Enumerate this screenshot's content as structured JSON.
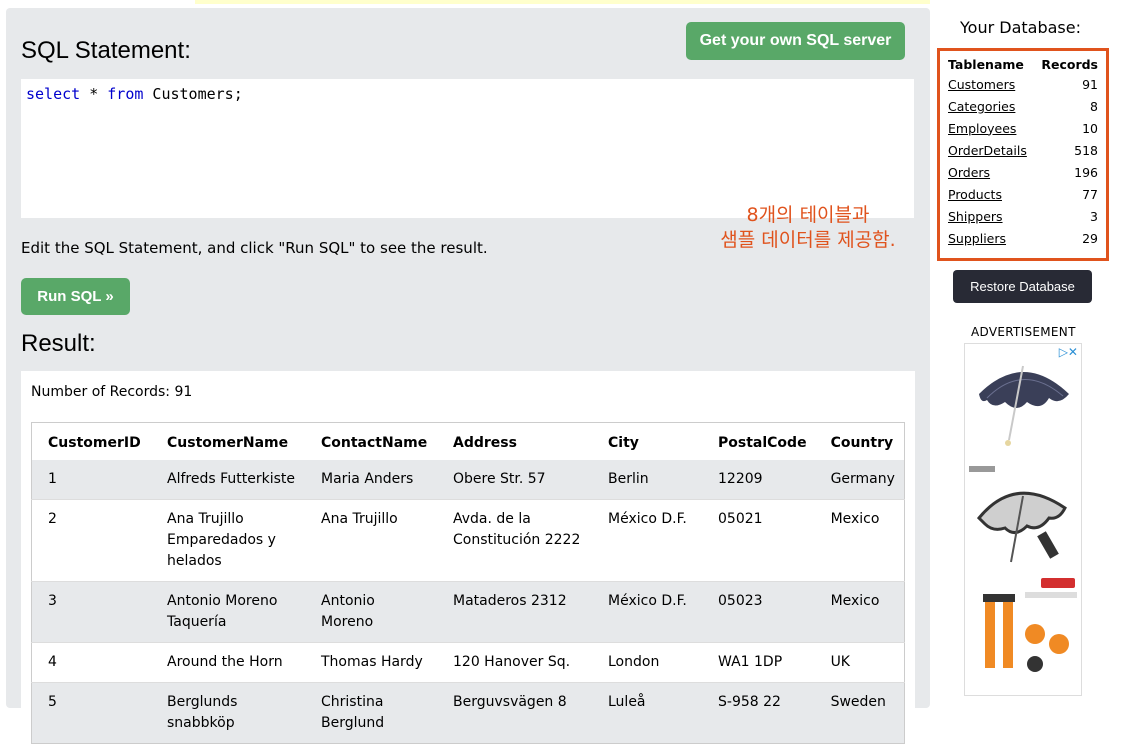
{
  "main": {
    "sql_title": "SQL Statement:",
    "server_button": "Get your own SQL server",
    "query": {
      "kw1": "select",
      "star": " * ",
      "kw2": "from",
      "rest": " Customers;"
    },
    "hint": "Edit the SQL Statement, and click \"Run SQL\" to see the result.",
    "run_button": "Run SQL »",
    "result_title": "Result:",
    "record_count": "Number of Records: 91"
  },
  "results": {
    "columns": [
      "CustomerID",
      "CustomerName",
      "ContactName",
      "Address",
      "City",
      "PostalCode",
      "Country"
    ],
    "rows": [
      [
        "1",
        "Alfreds Futterkiste",
        "Maria Anders",
        "Obere Str. 57",
        "Berlin",
        "12209",
        "Germany"
      ],
      [
        "2",
        "Ana Trujillo Emparedados y helados",
        "Ana Trujillo",
        "Avda. de la Constitución 2222",
        "México D.F.",
        "05021",
        "Mexico"
      ],
      [
        "3",
        "Antonio Moreno Taquería",
        "Antonio Moreno",
        "Mataderos 2312",
        "México D.F.",
        "05023",
        "Mexico"
      ],
      [
        "4",
        "Around the Horn",
        "Thomas Hardy",
        "120 Hanover Sq.",
        "London",
        "WA1 1DP",
        "UK"
      ],
      [
        "5",
        "Berglunds snabbköp",
        "Christina Berglund",
        "Berguvsvägen 8",
        "Luleå",
        "S-958 22",
        "Sweden"
      ]
    ]
  },
  "sidebar": {
    "title": "Your Database:",
    "table_header": {
      "name": "Tablename",
      "records": "Records"
    },
    "tables": [
      {
        "name": "Customers",
        "records": "91"
      },
      {
        "name": "Categories",
        "records": "8"
      },
      {
        "name": "Employees",
        "records": "10"
      },
      {
        "name": "OrderDetails",
        "records": "518"
      },
      {
        "name": "Orders",
        "records": "196"
      },
      {
        "name": "Products",
        "records": "77"
      },
      {
        "name": "Shippers",
        "records": "3"
      },
      {
        "name": "Suppliers",
        "records": "29"
      }
    ],
    "annotation_line1": "8개의 테이블과",
    "annotation_line2": "샘플 데이터를 제공함.",
    "restore_button": "Restore Database",
    "ad_label": "ADVERTISEMENT",
    "ad_close": "▷✕"
  },
  "colors": {
    "accent_green": "#59a868",
    "annotation": "#e0531d",
    "dark_button": "#282a35",
    "panel": "#e7e9eb"
  }
}
